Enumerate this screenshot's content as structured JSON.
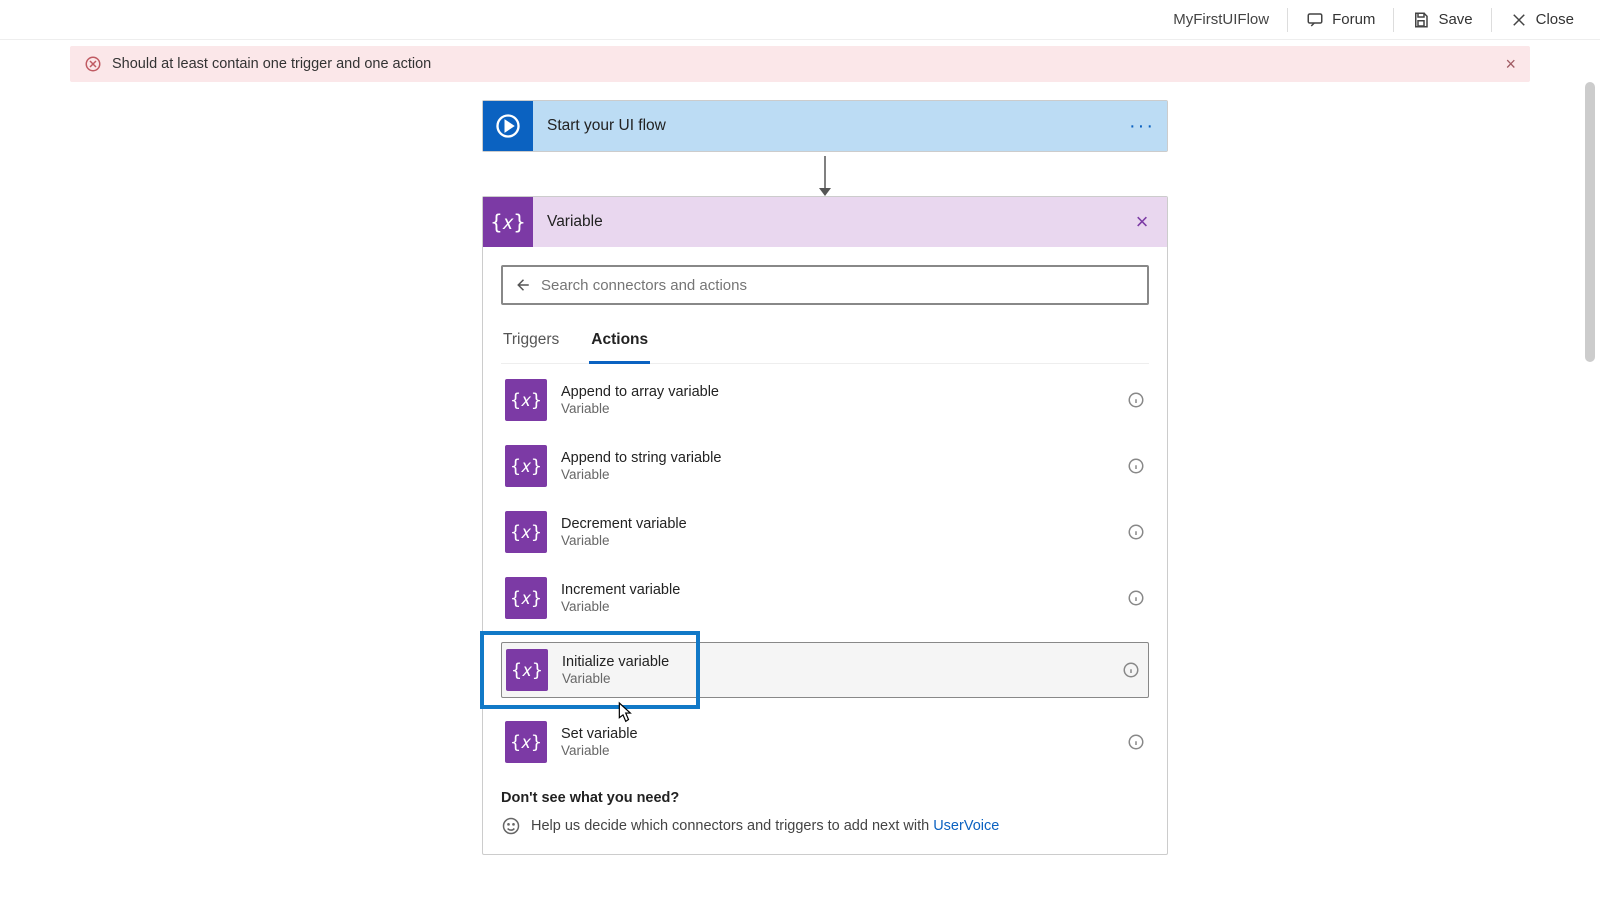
{
  "topbar": {
    "flow_name": "MyFirstUIFlow",
    "forum": "Forum",
    "save": "Save",
    "close": "Close"
  },
  "error": {
    "message": "Should at least contain one trigger and one action"
  },
  "start_card": {
    "title": "Start your UI flow"
  },
  "variable_card": {
    "title": "Variable",
    "search_placeholder": "Search connectors and actions",
    "tabs": {
      "triggers": "Triggers",
      "actions": "Actions"
    },
    "actions": [
      {
        "name": "Append to array variable",
        "sub": "Variable"
      },
      {
        "name": "Append to string variable",
        "sub": "Variable"
      },
      {
        "name": "Decrement variable",
        "sub": "Variable"
      },
      {
        "name": "Increment variable",
        "sub": "Variable"
      },
      {
        "name": "Initialize variable",
        "sub": "Variable"
      },
      {
        "name": "Set variable",
        "sub": "Variable"
      }
    ],
    "footer": {
      "question": "Don't see what you need?",
      "help_text": "Help us decide which connectors and triggers to add next with ",
      "link_text": "UserVoice"
    }
  }
}
